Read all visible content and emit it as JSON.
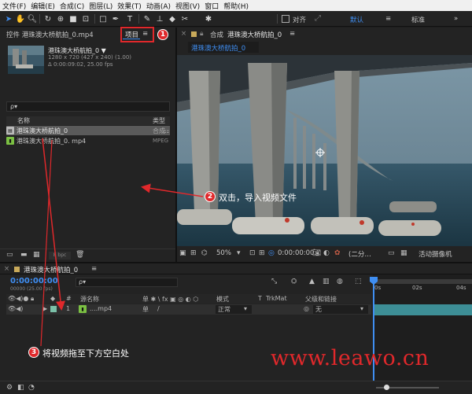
{
  "menu": [
    "文件(F)",
    "编辑(E)",
    "合成(C)",
    "图层(L)",
    "效果(T)",
    "动画(A)",
    "视图(V)",
    "窗口",
    "帮助(H)"
  ],
  "toolbar": {
    "snap_label": "对齐",
    "workspace_default": "默认",
    "workspace_menu": "≡",
    "workspace_standard": "标准"
  },
  "project_panel": {
    "control_tab": "控件 港珠澳大桥航拍_0.mp4",
    "project_tab": "项目",
    "project_menu": "≡",
    "item_name": "港珠澳大桥航拍_0 ▼",
    "item_meta1": "1280 x 720 (427 x 240) (1.00)",
    "item_meta2": "Δ 0:00:09:02, 25.00 fps",
    "search_placeholder": "ρ▾",
    "col_name": "名称",
    "col_type": "类型",
    "rows": [
      {
        "name": "港珠澳大桥航拍_0",
        "type": "合成"
      },
      {
        "name": "港珠澳大桥航拍_0. mp4",
        "type": "MPEG"
      }
    ],
    "bpc": "8 bpc"
  },
  "comp_panel": {
    "tab_prefix": "合成",
    "tab_name": "港珠澳大桥航拍_0",
    "tab_menu": "≡",
    "sub_tab": "港珠澳大桥航拍_0",
    "zoom": "50%",
    "timecode": "0:00:00:00",
    "resolution": "(二分…",
    "camera": "活动摄像机"
  },
  "timeline": {
    "tab_name": "港珠澳大桥航拍_0",
    "tab_menu": "≡",
    "timecode": "0:00:00:00",
    "timecode_sub": "00000 (25.00 fps)",
    "search_placeholder": "ρ▾",
    "col_num": "#",
    "col_source": "源名称",
    "col_switches": "单 ✱ \\ fx ▣ ◎ ◐ ⬡",
    "col_mode": "模式",
    "col_t": "T",
    "col_trkmat": "TrkMat",
    "col_parent": "父级和链接",
    "ruler": [
      "0s",
      "02s",
      "04s"
    ],
    "layer": {
      "num": "1",
      "name": "....mp4",
      "mode": "正常",
      "parent": "无",
      "switch": "单"
    }
  },
  "annotations": [
    {
      "num": "1",
      "text": ""
    },
    {
      "num": "2",
      "text": "双击，导入视频文件"
    },
    {
      "num": "3",
      "text": "将视频拖至下方空白处"
    }
  ],
  "watermark": "www.leawo.cn",
  "colors": {
    "accent": "#3f8ef2",
    "annotation": "#e0282b",
    "watermark": "#e0282b",
    "timecode": "#3f8ef2"
  }
}
